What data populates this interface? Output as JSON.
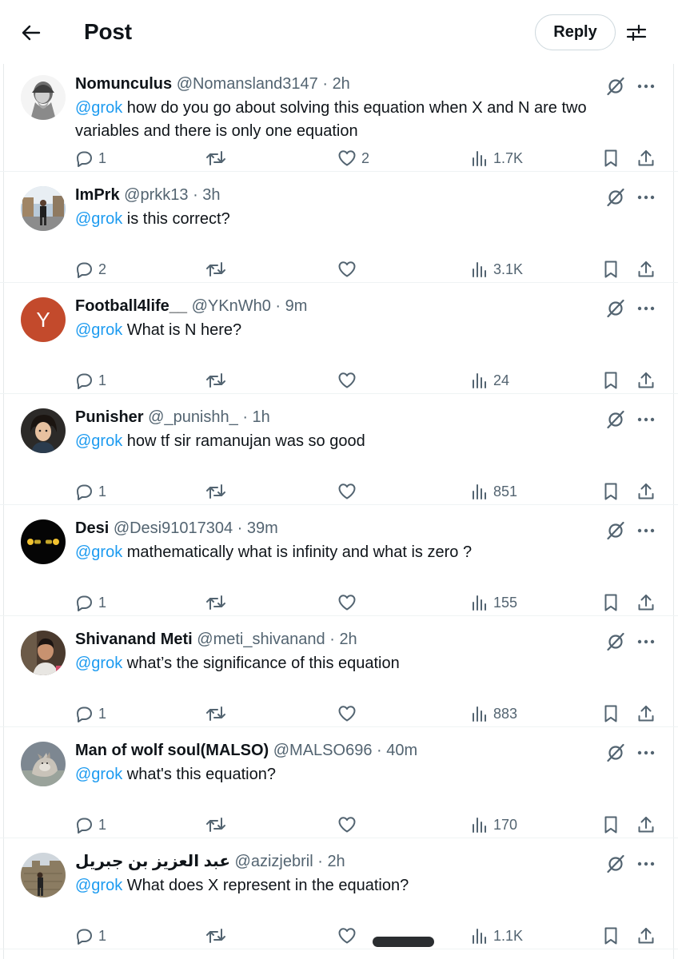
{
  "header": {
    "title": "Post",
    "reply_label": "Reply"
  },
  "colors": {
    "mention": "#1d9bf0",
    "secondary_text": "#536471",
    "avatar_y_bg": "#c34a2c"
  },
  "tweets": [
    {
      "name": "Nomunculus",
      "handle": "@Nomansland3147",
      "time": "2h",
      "mention": "@grok",
      "text": " how do you go about solving this equation when X and N are two variables and there is only one equation",
      "replies": "1",
      "retweets": "",
      "likes": "2",
      "views": "1.7K",
      "avatar": "bust-statue"
    },
    {
      "name": "ImPrk",
      "handle": "@prkk13",
      "time": "3h",
      "mention": "@grok",
      "text": " is this correct?",
      "replies": "2",
      "retweets": "",
      "likes": "",
      "views": "3.1K",
      "avatar": "person-street"
    },
    {
      "name": "Football4life__",
      "handle": "@YKnWh0",
      "time": "9m",
      "mention": "@grok",
      "text": " What is N here?",
      "replies": "1",
      "retweets": "",
      "likes": "",
      "views": "24",
      "avatar": "letter",
      "avatar_letter": "Y"
    },
    {
      "name": "Punisher",
      "handle": "@_punishh_",
      "time": "1h",
      "mention": "@grok",
      "text": " how tf sir ramanujan was so good",
      "replies": "1",
      "retweets": "",
      "likes": "",
      "views": "851",
      "avatar": "anime-character"
    },
    {
      "name": "Desi",
      "handle": "@Desi91017304",
      "time": "39m",
      "mention": "@grok",
      "text": " mathematically what is infinity and what is zero ?",
      "replies": "1",
      "retweets": "",
      "likes": "",
      "views": "155",
      "avatar": "dark-emoji"
    },
    {
      "name": "Shivanand Meti",
      "handle": "@meti_shivanand",
      "time": "2h",
      "mention": "@grok",
      "text": " what’s the significance of this equation",
      "replies": "1",
      "retweets": "",
      "likes": "",
      "views": "883",
      "avatar": "person-portrait"
    },
    {
      "name": "Man of wolf soul(MALSO)",
      "handle": "@MALSO696",
      "time": "40m",
      "mention": "@grok",
      "text": " what's this equation?",
      "replies": "1",
      "retweets": "",
      "likes": "",
      "views": "170",
      "avatar": "wolf"
    },
    {
      "name": "عبد العزيز بن جبريل",
      "handle": "@azizjebril",
      "time": "2h",
      "mention": "@grok",
      "text": " What does X represent in the equation?",
      "replies": "1",
      "retweets": "",
      "likes": "",
      "views": "1.1K",
      "avatar": "person-ruins"
    }
  ]
}
